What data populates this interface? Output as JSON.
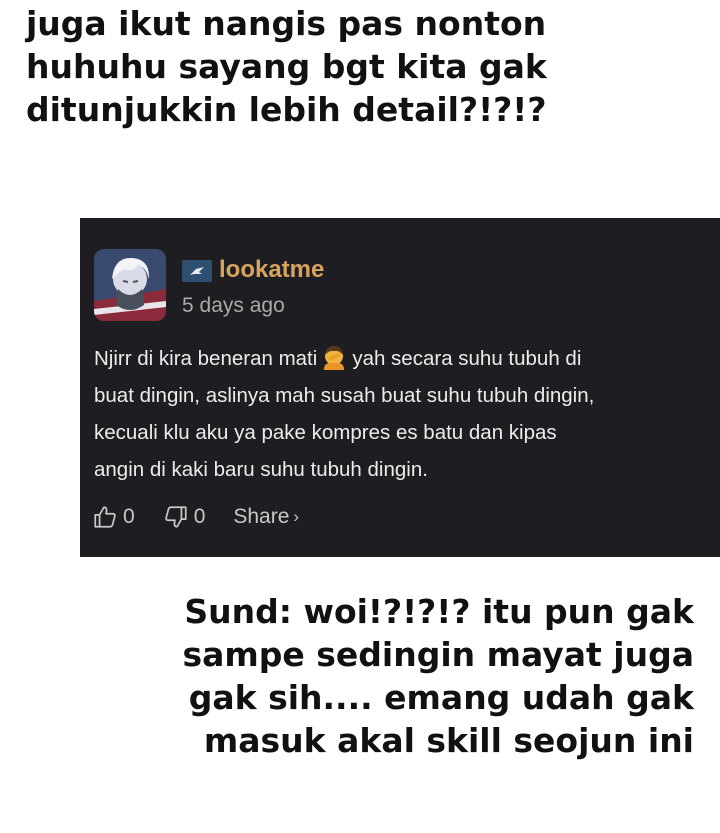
{
  "top_caption": {
    "lines": [
      "juga ikut nangis pas nonton",
      "huhuhu sayang bgt kita gak",
      "ditunjukkin lebih detail?!?!?"
    ]
  },
  "comment": {
    "username": "lookatme",
    "timestamp": "5 days ago",
    "body_lines": [
      "Njirr di kira beneran mati",
      "yah secara suhu tubuh di",
      "buat dingin, aslinya mah susah buat suhu tubuh dingin,",
      "kecuali klu aku ya pake kompres es batu dan kipas",
      "angin di kaki baru suhu tubuh dingin."
    ],
    "emoji": "person-facepalming-emoji",
    "likes": "0",
    "dislikes": "0",
    "share_label": "Share",
    "share_chevron": "›",
    "username_color": "#d8a35c",
    "card_background": "#1e1e22"
  },
  "bottom_caption": {
    "lines": [
      "Sund: woi!?!?!? itu pun gak",
      "sampe sedingin mayat juga",
      "gak sih.... emang udah gak",
      "masuk akal skill seojun ini"
    ]
  },
  "icons": {
    "like": "thumbs-up-icon",
    "dislike": "thumbs-down-icon",
    "badge": "rank-badge-icon"
  }
}
